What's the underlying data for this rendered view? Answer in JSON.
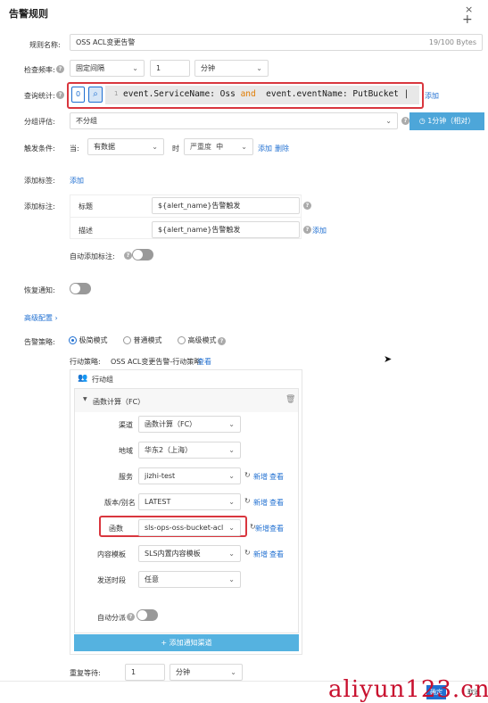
{
  "dialog": {
    "title": "告警规则"
  },
  "rule_name": {
    "label": "规则名称:",
    "value": "OSS ACL变更告警",
    "counter": "19/100 Bytes"
  },
  "frequency": {
    "label": "检查频率:",
    "mode": "固定间隔",
    "num": "1",
    "unit": "分钟"
  },
  "query": {
    "label": "查询统计:",
    "index": "0",
    "line_no": "1",
    "text_pre": "event.ServiceName: Oss ",
    "text_kw": "and",
    "text_post": "  event.eventName: PutBucket |",
    "add_label": "添加",
    "time_button": "1分钟（相对）"
  },
  "group": {
    "label": "分组评估:",
    "value": "不分组"
  },
  "trigger": {
    "label": "触发条件:",
    "when": "当:",
    "cond": "有数据",
    "then": "时",
    "severity_label": "严重度",
    "severity": "中",
    "add": "添加",
    "delete": "删除"
  },
  "tags": {
    "label": "添加标签:",
    "add": "添加"
  },
  "annotations": {
    "label": "添加标注:",
    "rows": [
      {
        "key": "标题",
        "value": "${alert_name}告警触发"
      },
      {
        "key": "描述",
        "value": "${alert_name}告警触发"
      }
    ],
    "add": "添加",
    "auto_label": "自动添加标注:"
  },
  "recovery": {
    "label": "恢复通知:"
  },
  "advanced": {
    "label": "高级配置"
  },
  "policy": {
    "label": "告警策略:",
    "options": [
      "极简模式",
      "普通模式",
      "高级模式"
    ],
    "selected": 0
  },
  "action_policy": {
    "label": "行动策略:",
    "value": "OSS ACL变更告警-行动策略",
    "view": "查看"
  },
  "action_group": {
    "title": "行动组",
    "fc_title": "函数计算（FC）",
    "fields": [
      {
        "label": "渠道",
        "value": "函数计算（FC）"
      },
      {
        "label": "地域",
        "value": "华东2（上海）"
      },
      {
        "label": "服务",
        "value": "jizhi-test",
        "new": "新增",
        "view": "查看"
      },
      {
        "label": "版本/别名",
        "value": "LATEST",
        "new": "新增",
        "view": "查看"
      },
      {
        "label": "函数",
        "value": "sls-ops-oss-bucket-acl",
        "new": "新增",
        "view": "查看"
      },
      {
        "label": "内容模板",
        "value": "SLS内置内容模板",
        "new": "新增",
        "view": "查看"
      },
      {
        "label": "发送时段",
        "value": "任意"
      }
    ],
    "auto_dispatch": "自动分派",
    "add_channel": "添加通知渠道"
  },
  "repeat": {
    "label": "重复等待:",
    "num": "1",
    "unit": "分钟"
  },
  "footer": {
    "confirm": "确定",
    "cancel": "取消"
  },
  "watermark": "aliyun123.cn",
  "colors": {
    "accent": "#1f6fd1",
    "highlight": "#d9363e",
    "time_button": "#4da6d9",
    "channel_button": "#55b2e0"
  }
}
